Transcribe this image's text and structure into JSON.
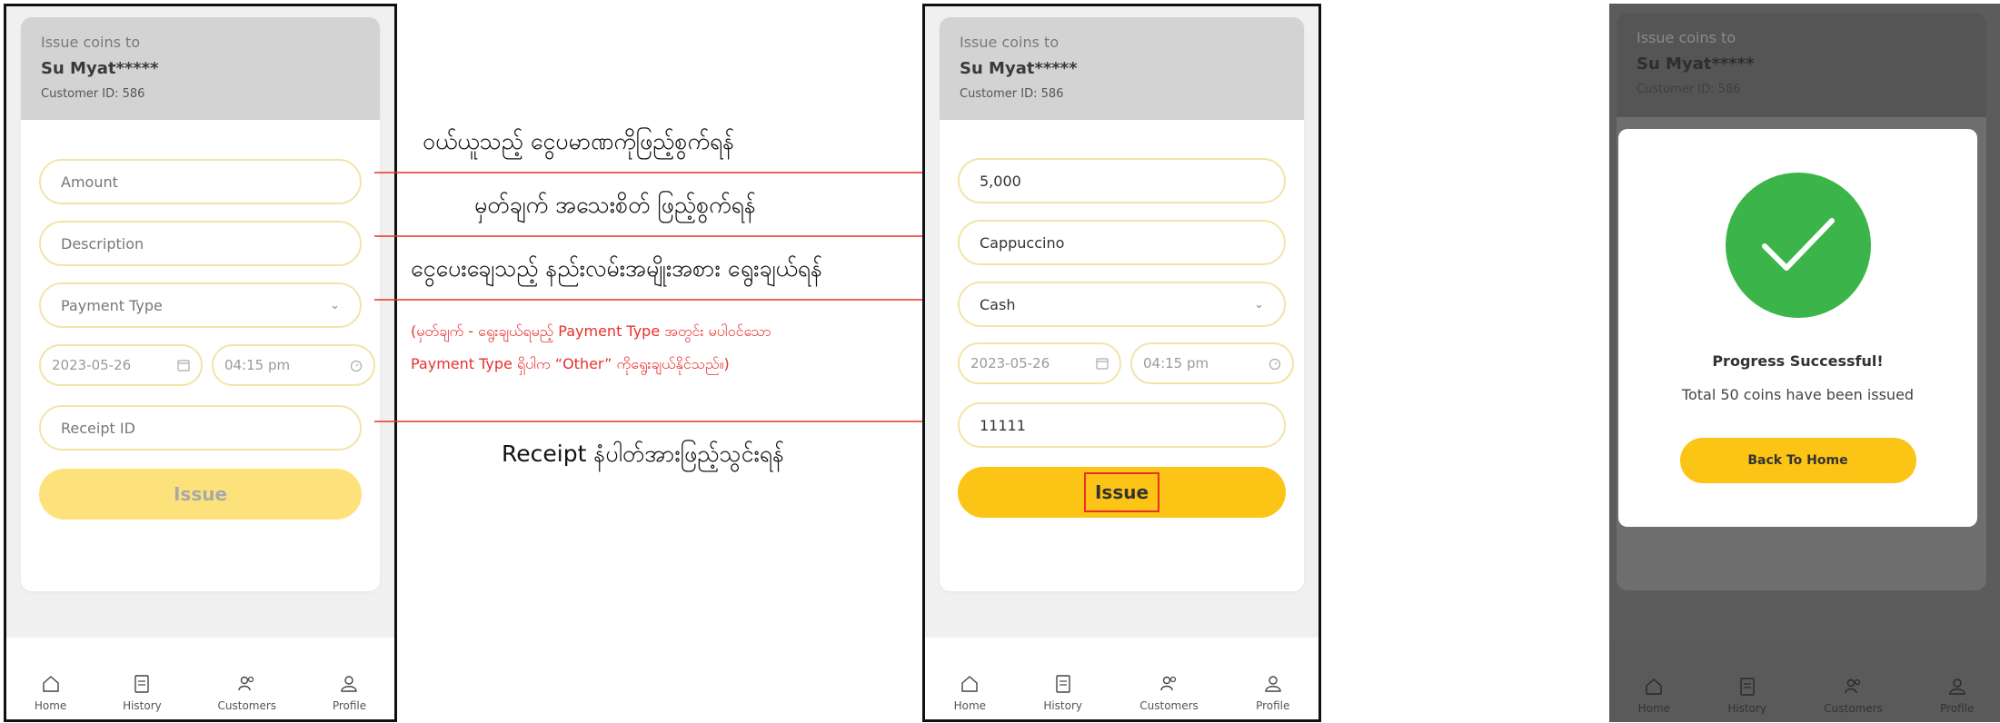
{
  "card": {
    "caption": "Issue coins to",
    "customer_name": "Su Myat*****",
    "customer_id": "Customer ID: 586"
  },
  "form_empty": {
    "amount_placeholder": "Amount",
    "description_placeholder": "Description",
    "payment_type_placeholder": "Payment Type",
    "date": "2023-05-26",
    "time": "04:15 pm",
    "receipt_placeholder": "Receipt ID",
    "issue_label": "Issue"
  },
  "form_filled": {
    "amount": "5,000",
    "description": "Cappuccino",
    "payment_type": "Cash",
    "date": "2023-05-26",
    "time": "04:15 pm",
    "receipt_id": "11111",
    "issue_label": "Issue"
  },
  "annotations": {
    "amount_note": "ဝယ်ယူသည့် ငွေပမာဏကိုဖြည့်စွက်ရန်",
    "description_note": "မှတ်ချက် အသေးစိတ် ဖြည့်စွက်ရန်",
    "payment_note": "ငွေပေးချေသည့် နည်းလမ်းအမျိုးအစား ရွေးချယ်ရန်",
    "payment_sub_line1": "(မှတ်ချက် - ရွေးချယ်ရမည့် Payment Type အတွင်း မပါဝင်သော",
    "payment_sub_line2": "Payment Type ရှိပါက “Other” ကိုရွေးချယ်နိုင်သည်။)",
    "receipt_note": "Receipt နံပါတ်အားဖြည့်သွင်းရန်"
  },
  "success_dialog": {
    "title": "Progress Successful!",
    "message": "Total 50 coins have been issued",
    "button": "Back To Home"
  },
  "nav": {
    "home": "Home",
    "history": "History",
    "customers": "Customers",
    "profile": "Profile"
  },
  "colors": {
    "accent": "#fcc414",
    "accent_disabled": "#fde27c",
    "field_border": "#f2e4a8",
    "arrow": "#e8302a",
    "success": "#3bb54a"
  }
}
